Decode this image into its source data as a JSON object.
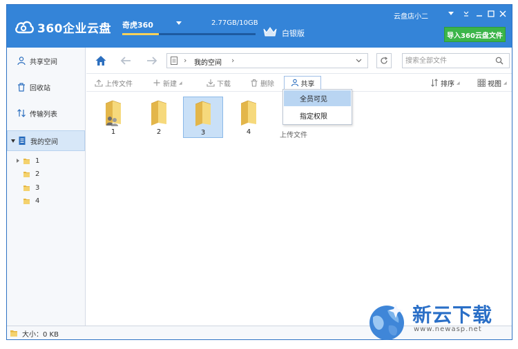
{
  "app": {
    "name": "360企业云盘",
    "account": "奇虎360",
    "storage_text": "2.77GB/10GB",
    "storage_used_fraction": 0.277,
    "tier": "白银版",
    "username": "云盘店小二",
    "import_button": "导入360云盘文件"
  },
  "sidebar": {
    "items": [
      {
        "label": "共享空间",
        "icon": "users-icon"
      },
      {
        "label": "回收站",
        "icon": "trash-icon"
      },
      {
        "label": "传输列表",
        "icon": "transfer-icon"
      },
      {
        "label": "我的空间",
        "icon": "document-icon",
        "active": true
      }
    ],
    "tree": [
      {
        "label": "1",
        "expandable": true
      },
      {
        "label": "2"
      },
      {
        "label": "3"
      },
      {
        "label": "4"
      }
    ]
  },
  "nav": {
    "path_label": "我的空间",
    "search_placeholder": "搜索全部文件"
  },
  "toolbar": {
    "upload": "上传文件",
    "new": "新建",
    "download": "下载",
    "delete": "删除",
    "share": "共享",
    "sort": "排序",
    "view": "视图"
  },
  "share_menu": {
    "items": [
      "全员可见",
      "指定权限"
    ]
  },
  "files": [
    {
      "name": "1",
      "shared": true
    },
    {
      "name": "2"
    },
    {
      "name": "3",
      "selected": true
    },
    {
      "name": "4"
    }
  ],
  "upload_label": "上传文件",
  "status": {
    "size_text": "大小：0 KB"
  },
  "watermark": {
    "title": "新云下载",
    "url": "www.newasp.net"
  },
  "colors": {
    "header": "#3484d8",
    "accent_green": "#3bb549",
    "selection": "#c9e0f7"
  }
}
